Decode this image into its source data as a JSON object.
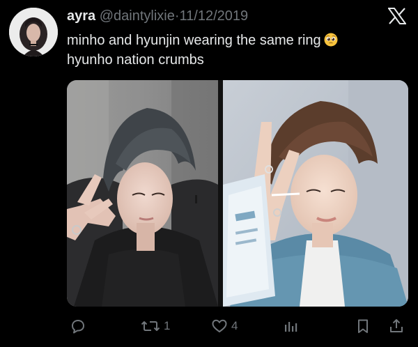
{
  "tweet": {
    "author": {
      "display_name": "ayra",
      "handle": "@daintylixie",
      "separator": "·",
      "date": "11/12/2019"
    },
    "text_lines": [
      "minho and hyunjin wearing the same ring",
      "hyunho nation crumbs"
    ],
    "emoji": "pleading-face-emoji",
    "media": [
      {
        "name": "photo-left",
        "description_icon": "photo"
      },
      {
        "name": "photo-right",
        "description_icon": "photo"
      }
    ],
    "metrics": {
      "replies": "",
      "retweets": "1",
      "likes": "4"
    }
  },
  "icons": {
    "brand": "x-logo-icon",
    "reply": "reply-icon",
    "retweet": "retweet-icon",
    "like": "heart-icon",
    "views": "views-chart-icon",
    "bookmark": "bookmark-icon",
    "share": "share-icon"
  },
  "colors": {
    "background": "#000000",
    "primary_text": "#e7e9ea",
    "secondary_text": "#71767b"
  }
}
